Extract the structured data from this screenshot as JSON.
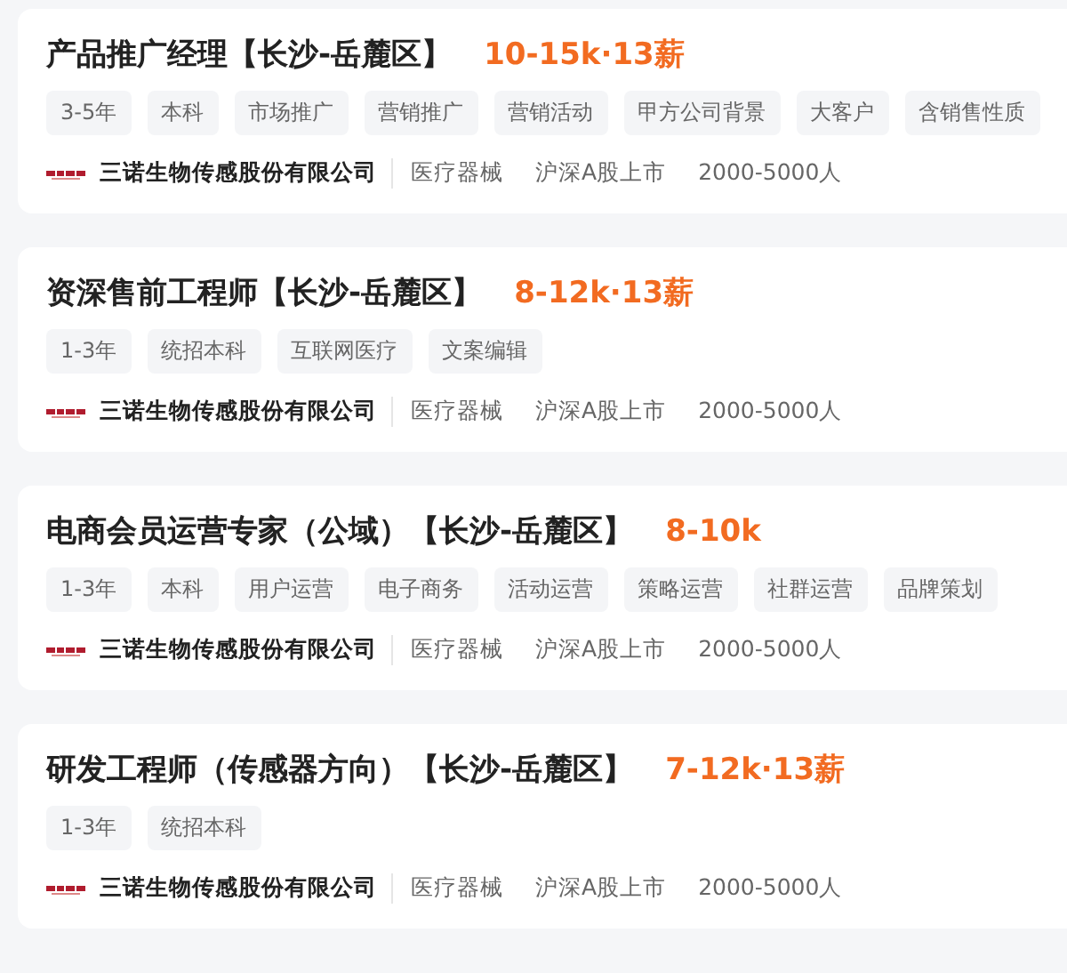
{
  "jobs": [
    {
      "title": "产品推广经理【长沙-岳麓区】",
      "salary": "10-15k·13薪",
      "tags": [
        "3-5年",
        "本科",
        "市场推广",
        "营销推广",
        "营销活动",
        "甲方公司背景",
        "大客户",
        "含销售性质"
      ],
      "company": "三诺生物传感股份有限公司",
      "company_info": [
        "医疗器械",
        "沪深A股上市",
        "2000-5000人"
      ]
    },
    {
      "title": "资深售前工程师【长沙-岳麓区】",
      "salary": "8-12k·13薪",
      "tags": [
        "1-3年",
        "统招本科",
        "互联网医疗",
        "文案编辑"
      ],
      "company": "三诺生物传感股份有限公司",
      "company_info": [
        "医疗器械",
        "沪深A股上市",
        "2000-5000人"
      ]
    },
    {
      "title": "电商会员运营专家（公域）【长沙-岳麓区】",
      "salary": "8-10k",
      "tags": [
        "1-3年",
        "本科",
        "用户运营",
        "电子商务",
        "活动运营",
        "策略运营",
        "社群运营",
        "品牌策划"
      ],
      "company": "三诺生物传感股份有限公司",
      "company_info": [
        "医疗器械",
        "沪深A股上市",
        "2000-5000人"
      ]
    },
    {
      "title": "研发工程师（传感器方向）【长沙-岳麓区】",
      "salary": "7-12k·13薪",
      "tags": [
        "1-3年",
        "统招本科"
      ],
      "company": "三诺生物传感股份有限公司",
      "company_info": [
        "医疗器械",
        "沪深A股上市",
        "2000-5000人"
      ]
    }
  ]
}
